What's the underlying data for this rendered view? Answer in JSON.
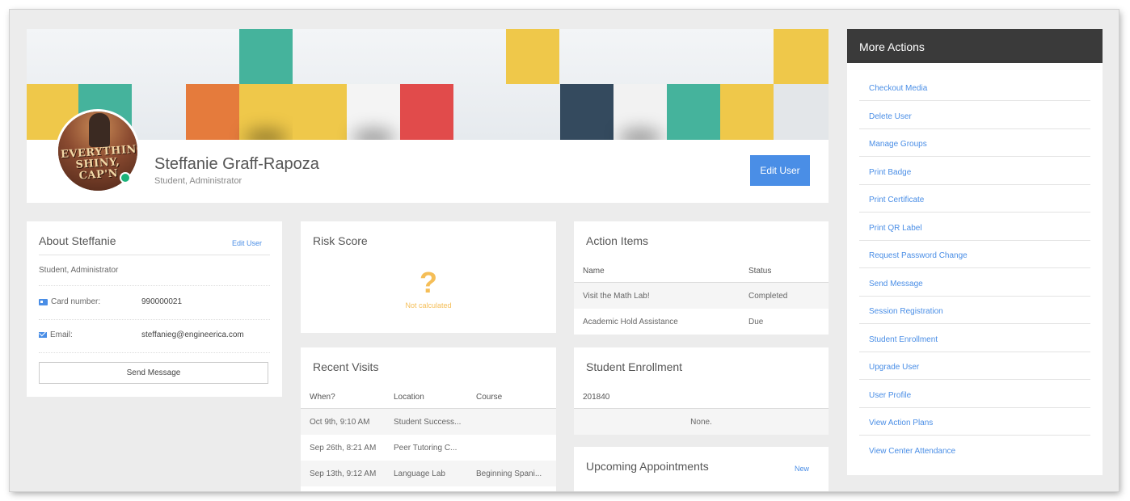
{
  "profile": {
    "name": "Steffanie Graff-Rapoza",
    "roles": "Student, Administrator",
    "edit_button": "Edit User",
    "avatar_text": "EVERYTHING'S SHINY, CAP'N"
  },
  "about": {
    "title": "About Steffanie",
    "edit_link": "Edit User",
    "roles": "Student, Administrator",
    "card_label": "Card number:",
    "card_value": "990000021",
    "email_label": "Email:",
    "email_value": "steffanieg@engineerica.com",
    "send_button": "Send Message"
  },
  "risk": {
    "title": "Risk Score",
    "symbol": "?",
    "status": "Not calculated"
  },
  "visits": {
    "title": "Recent Visits",
    "columns": [
      "When?",
      "Location",
      "Course"
    ],
    "rows": [
      [
        "Oct 9th, 9:10 AM",
        "Student Success...",
        ""
      ],
      [
        "Sep 26th, 8:21 AM",
        "Peer Tutoring C...",
        ""
      ],
      [
        "Sep 13th, 9:12 AM",
        "Language Lab",
        "Beginning Spani..."
      ]
    ]
  },
  "action_items": {
    "title": "Action Items",
    "columns": [
      "Name",
      "Status"
    ],
    "rows": [
      [
        "Visit the Math Lab!",
        "Completed"
      ],
      [
        "Academic Hold Assistance",
        "Due"
      ]
    ]
  },
  "enrollment": {
    "title": "Student Enrollment",
    "term": "201840",
    "empty": "None."
  },
  "appointments": {
    "title": "Upcoming Appointments",
    "new_link": "New"
  },
  "more_actions": {
    "title": "More Actions",
    "items": [
      "Checkout Media",
      "Delete User",
      "Manage Groups",
      "Print Badge",
      "Print Certificate",
      "Print QR Label",
      "Request Password Change",
      "Send Message",
      "Session Registration",
      "Student Enrollment",
      "Upgrade User",
      "User Profile",
      "View Action Plans",
      "View Center Attendance"
    ]
  },
  "colors": {
    "accent": "#4a8ee6",
    "online": "#1bb37a",
    "warning": "#f5be57",
    "header_dark": "#3a3a3a",
    "banner_teal": "#45b39c",
    "banner_yellow": "#efc84a",
    "banner_orange": "#e57b3c",
    "banner_red": "#e14b4b",
    "banner_navy": "#344a5e"
  }
}
